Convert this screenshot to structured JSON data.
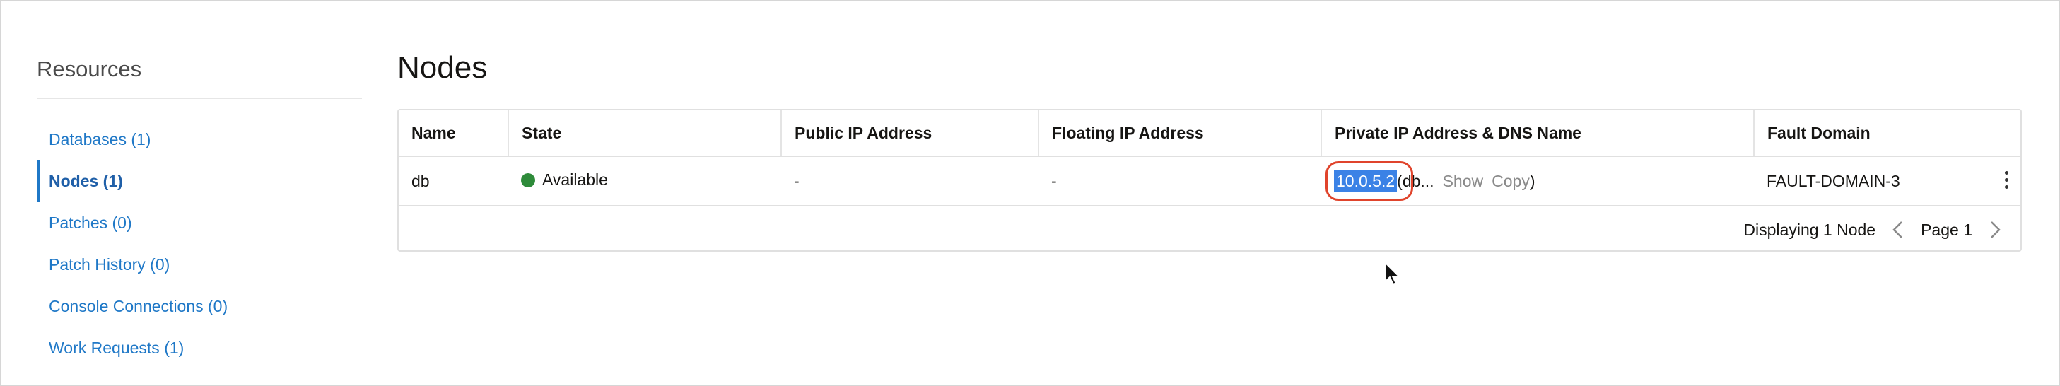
{
  "sidebar": {
    "title": "Resources",
    "items": [
      {
        "label": "Databases (1)"
      },
      {
        "label": "Nodes (1)"
      },
      {
        "label": "Patches (0)"
      },
      {
        "label": "Patch History (0)"
      },
      {
        "label": "Console Connections (0)"
      },
      {
        "label": "Work Requests (1)"
      }
    ],
    "active_item": "Nodes (1)"
  },
  "main": {
    "title": "Nodes",
    "table": {
      "columns": [
        "Name",
        "State",
        "Public IP Address",
        "Floating IP Address",
        "Private IP Address & DNS Name",
        "Fault Domain"
      ],
      "rows": [
        {
          "name": "db",
          "state": "Available",
          "public_ip": "-",
          "floating_ip": "-",
          "private_ip": "10.0.5.2",
          "dns_open": "(",
          "dns_truncated": "db...",
          "show_label": "Show",
          "copy_label": "Copy",
          "dns_close": ")",
          "fault_domain": "FAULT-DOMAIN-3"
        }
      ]
    },
    "pager": {
      "displaying": "Displaying 1 Node",
      "page": "Page 1"
    }
  },
  "colors": {
    "link": "#1f78c7",
    "available": "#2e8b3a",
    "highlight_ring": "#e0442c",
    "selection": "#3b82e6"
  }
}
